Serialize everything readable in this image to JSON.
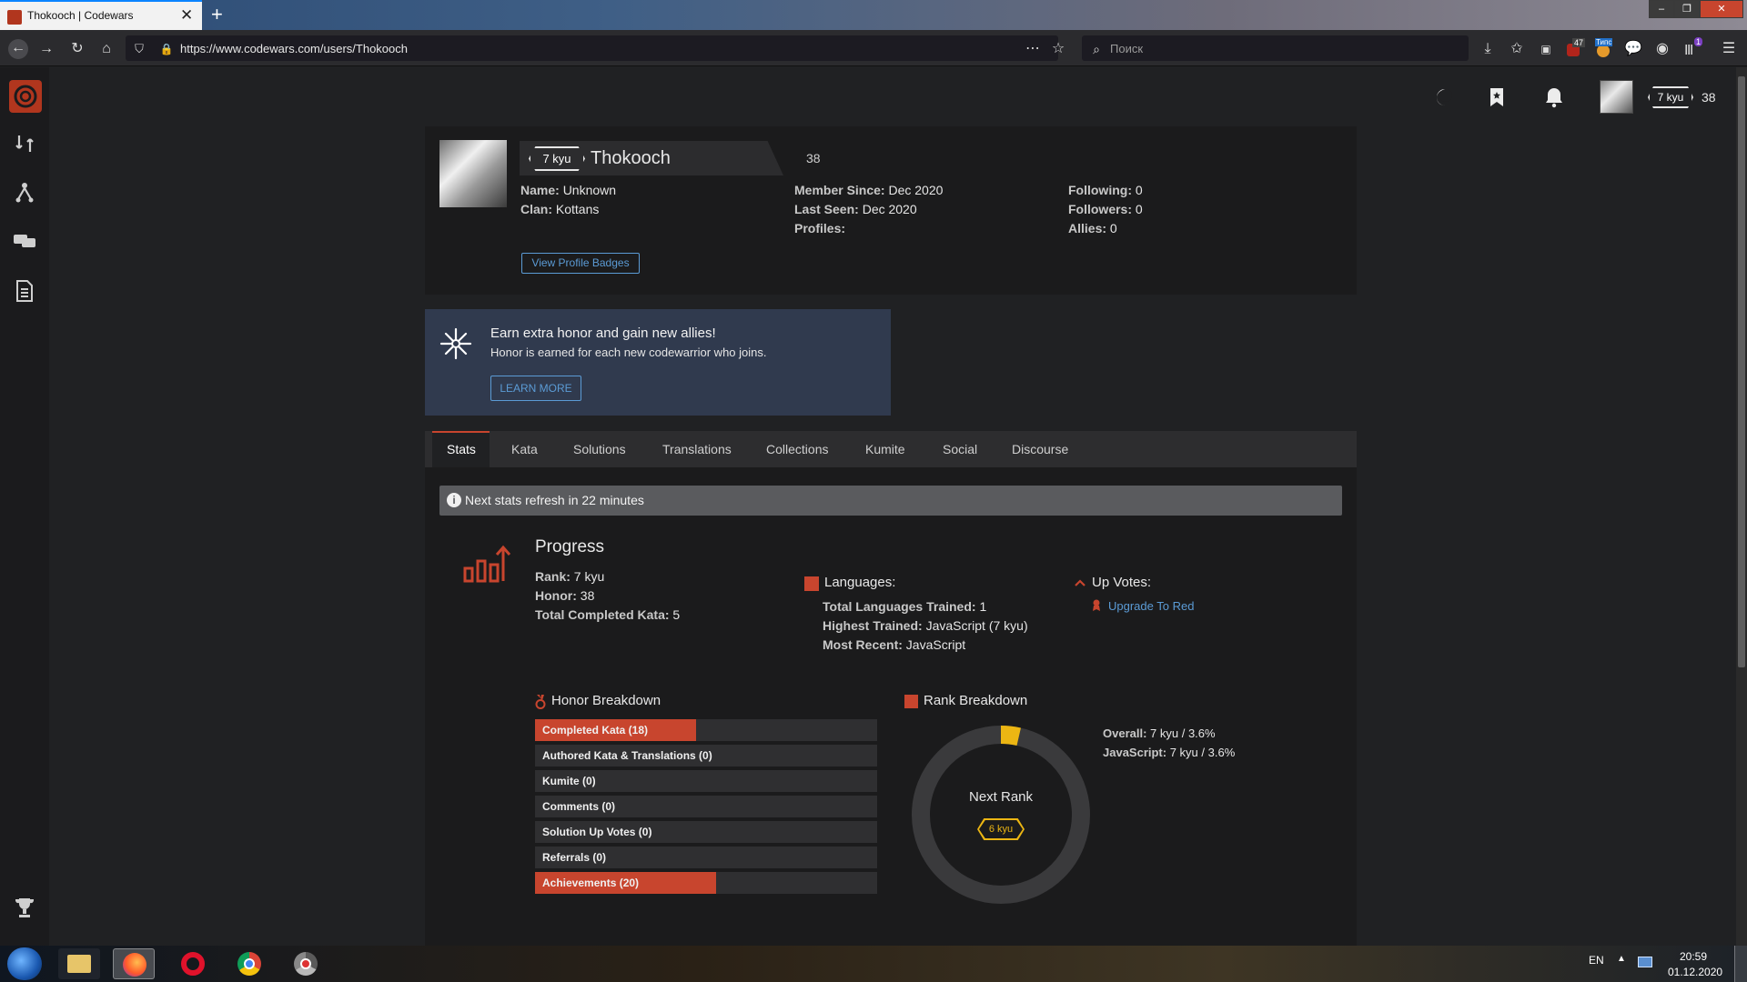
{
  "browser": {
    "tab_title": "Thokooch | Codewars",
    "new_tab": "+",
    "tab_close": "✕",
    "url": "https://www.codewars.com/users/Thokooch",
    "search_placeholder": "Поиск",
    "badge_count_1": "47",
    "badge_label_2": "Типс",
    "badge_count_3": "1",
    "window_buttons": [
      "–",
      "❐",
      "✕"
    ]
  },
  "topbar": {
    "rank": "7 kyu",
    "honor": "38"
  },
  "profile": {
    "rank": "7 kyu",
    "username": "Thokooch",
    "honor": "38",
    "name_label": "Name:",
    "name_value": "Unknown",
    "clan_label": "Clan:",
    "clan_value": "Kottans",
    "member_label": "Member Since:",
    "member_value": "Dec 2020",
    "seen_label": "Last Seen:",
    "seen_value": "Dec 2020",
    "profiles_label": "Profiles:",
    "following_label": "Following:",
    "following_value": "0",
    "followers_label": "Followers:",
    "followers_value": "0",
    "allies_label": "Allies:",
    "allies_value": "0",
    "badges_button": "View Profile Badges"
  },
  "referral": {
    "title": "Earn extra honor and gain new allies!",
    "text": "Honor is earned for each new codewarrior who joins.",
    "button": "LEARN MORE"
  },
  "tabs": [
    "Stats",
    "Kata",
    "Solutions",
    "Translations",
    "Collections",
    "Kumite",
    "Social",
    "Discourse"
  ],
  "notice": "Next stats refresh in 22 minutes",
  "progress": {
    "title": "Progress",
    "rank_label": "Rank:",
    "rank_value": "7 kyu",
    "honor_label": "Honor:",
    "honor_value": "38",
    "kata_label": "Total Completed Kata:",
    "kata_value": "5"
  },
  "languages": {
    "title": "Languages:",
    "trained_label": "Total Languages Trained:",
    "trained_value": "1",
    "highest_label": "Highest Trained:",
    "highest_value": "JavaScript (7 kyu)",
    "recent_label": "Most Recent:",
    "recent_value": "JavaScript"
  },
  "upvotes": {
    "title": "Up Votes:",
    "link": "Upgrade To Red"
  },
  "honor_breakdown": {
    "title": "Honor Breakdown",
    "items": [
      {
        "label": "Completed Kata (18)",
        "fill": 0.47
      },
      {
        "label": "Authored Kata & Translations (0)",
        "fill": 0
      },
      {
        "label": "Kumite (0)",
        "fill": 0
      },
      {
        "label": "Comments (0)",
        "fill": 0
      },
      {
        "label": "Solution Up Votes (0)",
        "fill": 0
      },
      {
        "label": "Referrals (0)",
        "fill": 0
      },
      {
        "label": "Achievements (20)",
        "fill": 0.53
      }
    ]
  },
  "rank_breakdown": {
    "title": "Rank Breakdown",
    "next_rank_label": "Next Rank",
    "next_rank": "6 kyu",
    "progress_fraction": 0.036,
    "overall_label": "Overall:",
    "overall_value": "7 kyu / 3.6%",
    "js_label": "JavaScript:",
    "js_value": "7 kyu / 3.6%"
  },
  "taskbar": {
    "lang": "EN",
    "time": "20:59",
    "date": "01.12.2020"
  },
  "colors": {
    "accent_red": "#c8452e",
    "link_blue": "#5b9bd5",
    "rank_yellow": "#ecb613"
  }
}
